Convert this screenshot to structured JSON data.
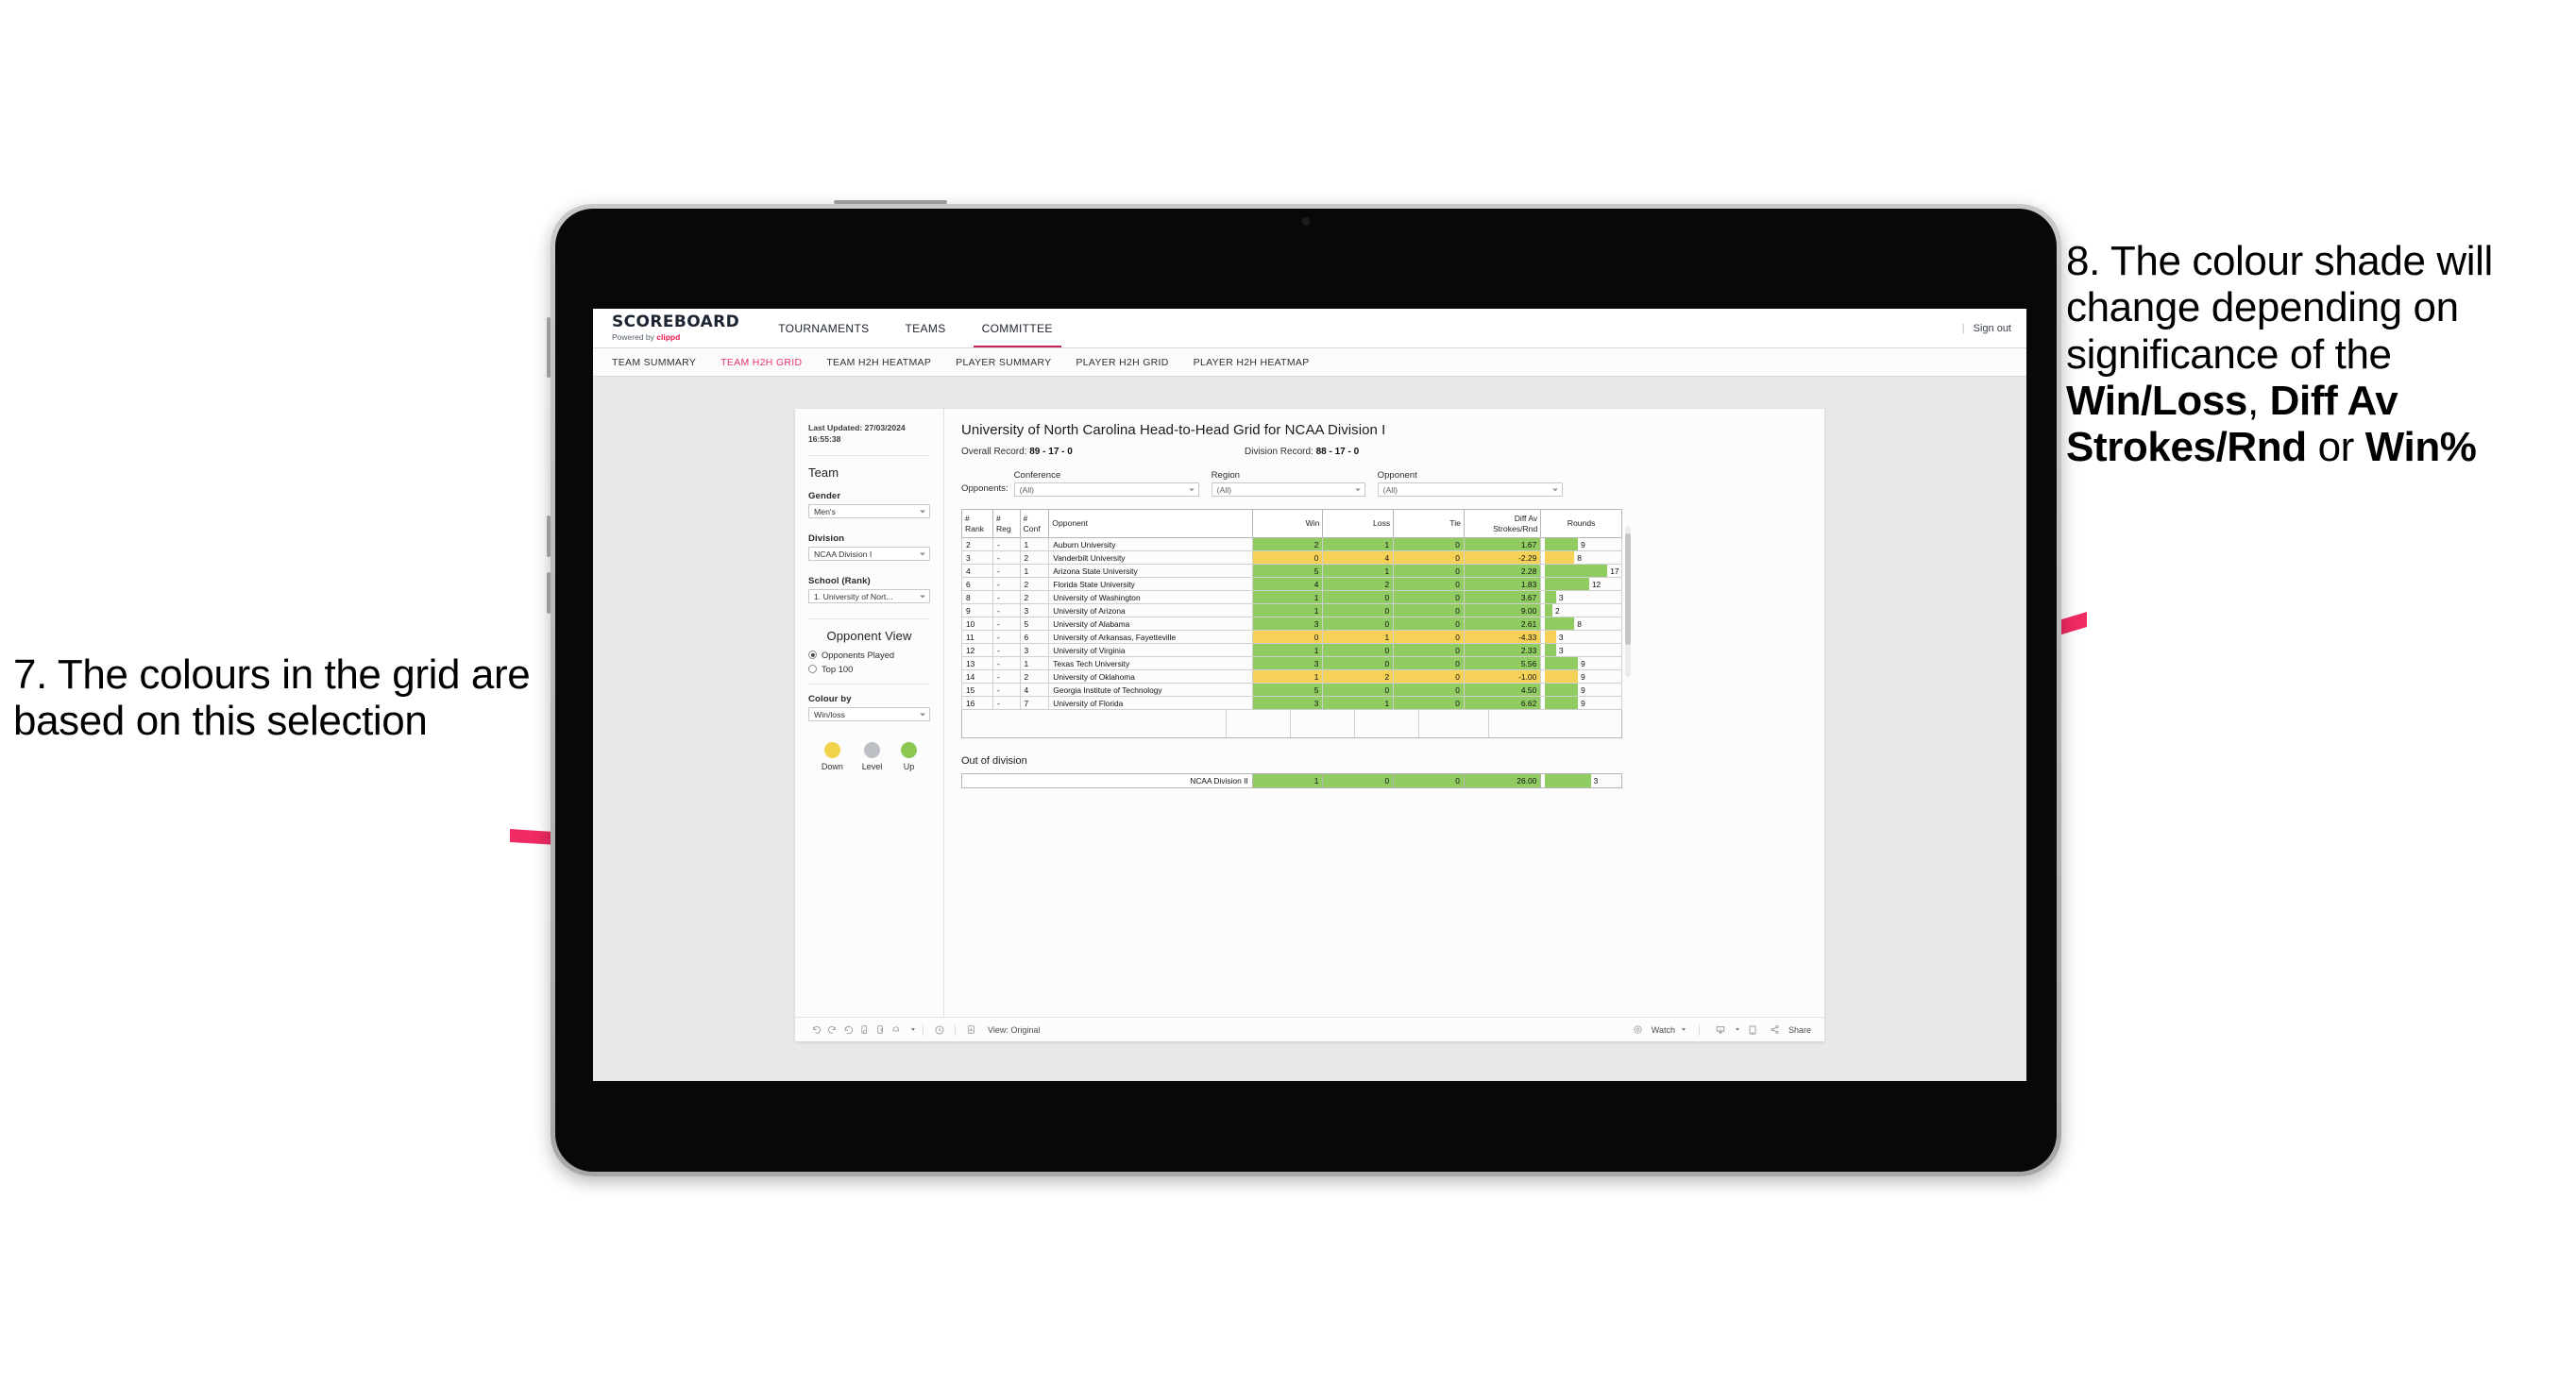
{
  "annotations": {
    "left": "7. The colours in the grid are based on this selection",
    "right_prefix": "8. The colour shade will change depending on significance of the ",
    "right_bold_1": "Win/Loss",
    "right_mid_1": ", ",
    "right_bold_2": "Diff Av Strokes/Rnd",
    "right_mid_2": " or ",
    "right_bold_3": "Win%",
    "arrow_color": "#f02a62"
  },
  "app": {
    "brand": {
      "title": "SCOREBOARD",
      "powered_prefix": "Powered by ",
      "powered_mark": "clippd"
    },
    "topnav": [
      {
        "label": "TOURNAMENTS",
        "active": false
      },
      {
        "label": "TEAMS",
        "active": false
      },
      {
        "label": "COMMITTEE",
        "active": true
      }
    ],
    "topnav_right": {
      "divider": "|",
      "sign_out": "Sign out"
    },
    "subnav": [
      {
        "label": "TEAM SUMMARY",
        "active": false
      },
      {
        "label": "TEAM H2H GRID",
        "active": true
      },
      {
        "label": "TEAM H2H HEATMAP",
        "active": false
      },
      {
        "label": "PLAYER SUMMARY",
        "active": false
      },
      {
        "label": "PLAYER H2H GRID",
        "active": false
      },
      {
        "label": "PLAYER H2H HEATMAP",
        "active": false
      }
    ]
  },
  "filters": {
    "last_updated_line1": "Last Updated: 27/03/2024",
    "last_updated_line2": "16:55:38",
    "team_heading": "Team",
    "gender_label": "Gender",
    "gender_value": "Men's",
    "division_label": "Division",
    "division_value": "NCAA Division I",
    "school_label": "School (Rank)",
    "school_value": "1. University of Nort...",
    "opponent_view_heading": "Opponent View",
    "opponent_view_options": [
      {
        "label": "Opponents Played",
        "checked": true
      },
      {
        "label": "Top 100",
        "checked": false
      }
    ],
    "colour_by_label": "Colour by",
    "colour_by_value": "Win/loss",
    "legend": [
      {
        "label": "Down",
        "color": "#f2d24b"
      },
      {
        "label": "Level",
        "color": "#bcc0c4"
      },
      {
        "label": "Up",
        "color": "#8cc751"
      }
    ]
  },
  "report": {
    "title": "University of North Carolina Head-to-Head Grid for NCAA Division I",
    "overall_record_label": "Overall Record: ",
    "overall_record_value": "89 - 17 - 0",
    "division_record_label": "Division Record: ",
    "division_record_value": "88 - 17 - 0",
    "opponents_label": "Opponents:",
    "opponent_filters": [
      {
        "caption": "Conference",
        "value": "(All)"
      },
      {
        "caption": "Region",
        "value": "(All)"
      },
      {
        "caption": "Opponent",
        "value": "(All)"
      }
    ],
    "columns": [
      {
        "line1": "#",
        "line2": "Rank"
      },
      {
        "line1": "#",
        "line2": "Reg"
      },
      {
        "line1": "#",
        "line2": "Conf"
      },
      {
        "line1": "Opponent",
        "line2": ""
      },
      {
        "line1": "Win",
        "line2": ""
      },
      {
        "line1": "Loss",
        "line2": ""
      },
      {
        "line1": "Tie",
        "line2": ""
      },
      {
        "line1": "Diff Av",
        "line2": "Strokes/Rnd"
      },
      {
        "line1": "Rounds",
        "line2": ""
      }
    ],
    "rows": [
      {
        "rank": "2",
        "reg": "-",
        "conf": "1",
        "opponent": "Auburn University",
        "win": "2",
        "loss": "1",
        "tie": "0",
        "diff": "1.67",
        "rounds": "9",
        "state": "up"
      },
      {
        "rank": "3",
        "reg": "-",
        "conf": "2",
        "opponent": "Vanderbilt University",
        "win": "0",
        "loss": "4",
        "tie": "0",
        "diff": "-2.29",
        "rounds": "8",
        "state": "down"
      },
      {
        "rank": "4",
        "reg": "-",
        "conf": "1",
        "opponent": "Arizona State University",
        "win": "5",
        "loss": "1",
        "tie": "0",
        "diff": "2.28",
        "rounds": "17",
        "state": "up"
      },
      {
        "rank": "6",
        "reg": "-",
        "conf": "2",
        "opponent": "Florida State University",
        "win": "4",
        "loss": "2",
        "tie": "0",
        "diff": "1.83",
        "rounds": "12",
        "state": "up"
      },
      {
        "rank": "8",
        "reg": "-",
        "conf": "2",
        "opponent": "University of Washington",
        "win": "1",
        "loss": "0",
        "tie": "0",
        "diff": "3.67",
        "rounds": "3",
        "state": "up"
      },
      {
        "rank": "9",
        "reg": "-",
        "conf": "3",
        "opponent": "University of Arizona",
        "win": "1",
        "loss": "0",
        "tie": "0",
        "diff": "9.00",
        "rounds": "2",
        "state": "up"
      },
      {
        "rank": "10",
        "reg": "-",
        "conf": "5",
        "opponent": "University of Alabama",
        "win": "3",
        "loss": "0",
        "tie": "0",
        "diff": "2.61",
        "rounds": "8",
        "state": "up"
      },
      {
        "rank": "11",
        "reg": "-",
        "conf": "6",
        "opponent": "University of Arkansas, Fayetteville",
        "win": "0",
        "loss": "1",
        "tie": "0",
        "diff": "-4.33",
        "rounds": "3",
        "state": "down"
      },
      {
        "rank": "12",
        "reg": "-",
        "conf": "3",
        "opponent": "University of Virginia",
        "win": "1",
        "loss": "0",
        "tie": "0",
        "diff": "2.33",
        "rounds": "3",
        "state": "up"
      },
      {
        "rank": "13",
        "reg": "-",
        "conf": "1",
        "opponent": "Texas Tech University",
        "win": "3",
        "loss": "0",
        "tie": "0",
        "diff": "5.56",
        "rounds": "9",
        "state": "up"
      },
      {
        "rank": "14",
        "reg": "-",
        "conf": "2",
        "opponent": "University of Oklahoma",
        "win": "1",
        "loss": "2",
        "tie": "0",
        "diff": "-1.00",
        "rounds": "9",
        "state": "down"
      },
      {
        "rank": "15",
        "reg": "-",
        "conf": "4",
        "opponent": "Georgia Institute of Technology",
        "win": "5",
        "loss": "0",
        "tie": "0",
        "diff": "4.50",
        "rounds": "9",
        "state": "up"
      },
      {
        "rank": "16",
        "reg": "-",
        "conf": "7",
        "opponent": "University of Florida",
        "win": "3",
        "loss": "1",
        "tie": "0",
        "diff": "6.62",
        "rounds": "9",
        "state": "up"
      }
    ],
    "out_of_division_title": "Out of division",
    "out_of_division_row": {
      "name": "NCAA Division II",
      "win": "1",
      "loss": "0",
      "tie": "0",
      "diff": "26.00",
      "rounds": "3",
      "state": "up"
    },
    "rounds_max": 17
  },
  "toolbar": {
    "view_label": "View: Original",
    "watch_label": "Watch",
    "share_label": "Share"
  },
  "chart_data": {
    "type": "table",
    "title": "University of North Carolina Head-to-Head Grid for NCAA Division I",
    "columns": [
      "# Rank",
      "# Reg",
      "# Conf",
      "Opponent",
      "Win",
      "Loss",
      "Tie",
      "Diff Av Strokes/Rnd",
      "Rounds"
    ],
    "colour_encoding": {
      "field": "Win/loss",
      "up": "#8cc751",
      "down": "#f2d24b",
      "level": "#bcc0c4"
    },
    "rows": [
      [
        "2",
        "-",
        "1",
        "Auburn University",
        2,
        1,
        0,
        1.67,
        9
      ],
      [
        "3",
        "-",
        "2",
        "Vanderbilt University",
        0,
        4,
        0,
        -2.29,
        8
      ],
      [
        "4",
        "-",
        "1",
        "Arizona State University",
        5,
        1,
        0,
        2.28,
        17
      ],
      [
        "6",
        "-",
        "2",
        "Florida State University",
        4,
        2,
        0,
        1.83,
        12
      ],
      [
        "8",
        "-",
        "2",
        "University of Washington",
        1,
        0,
        0,
        3.67,
        3
      ],
      [
        "9",
        "-",
        "3",
        "University of Arizona",
        1,
        0,
        0,
        9.0,
        2
      ],
      [
        "10",
        "-",
        "5",
        "University of Alabama",
        3,
        0,
        0,
        2.61,
        8
      ],
      [
        "11",
        "-",
        "6",
        "University of Arkansas, Fayetteville",
        0,
        1,
        0,
        -4.33,
        3
      ],
      [
        "12",
        "-",
        "3",
        "University of Virginia",
        1,
        0,
        0,
        2.33,
        3
      ],
      [
        "13",
        "-",
        "1",
        "Texas Tech University",
        3,
        0,
        0,
        5.56,
        9
      ],
      [
        "14",
        "-",
        "2",
        "University of Oklahoma",
        1,
        2,
        0,
        -1.0,
        9
      ],
      [
        "15",
        "-",
        "4",
        "Georgia Institute of Technology",
        5,
        0,
        0,
        4.5,
        9
      ],
      [
        "16",
        "-",
        "7",
        "University of Florida",
        3,
        1,
        0,
        6.62,
        9
      ]
    ],
    "out_of_division": [
      [
        "NCAA Division II",
        1,
        0,
        0,
        26.0,
        3
      ]
    ],
    "summary": {
      "overall_record": "89 - 17 - 0",
      "division_record": "88 - 17 - 0"
    }
  }
}
